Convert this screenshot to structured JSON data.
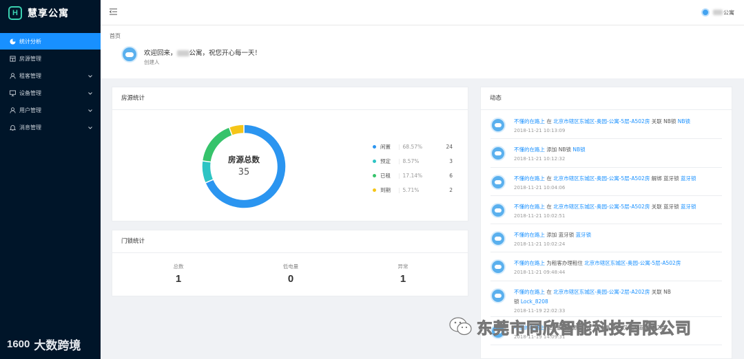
{
  "app": {
    "logo_mark": "H",
    "name": "慧享公寓"
  },
  "sidebar": {
    "items": [
      {
        "label": "统计分析",
        "icon": "pie-chart-icon",
        "active": true,
        "expandable": false
      },
      {
        "label": "房源管理",
        "icon": "building-icon",
        "active": false,
        "expandable": false
      },
      {
        "label": "租客管理",
        "icon": "user-icon",
        "active": false,
        "expandable": true
      },
      {
        "label": "设备管理",
        "icon": "monitor-icon",
        "active": false,
        "expandable": true
      },
      {
        "label": "用户管理",
        "icon": "user-icon",
        "active": false,
        "expandable": true
      },
      {
        "label": "消息管理",
        "icon": "bell-icon",
        "active": false,
        "expandable": true
      }
    ]
  },
  "topbar": {
    "user_name": "公寓"
  },
  "header": {
    "breadcrumb": "首页",
    "welcome_prefix": "欢迎回来，",
    "welcome_suffix": "公寓，祝您开心每一天！",
    "role": "创建人"
  },
  "room_stats": {
    "title": "房源统计",
    "center_label": "房源总数",
    "total": "35"
  },
  "chart_data": {
    "type": "pie",
    "title": "房源统计",
    "center_label": "房源总数",
    "total": 35,
    "slices": [
      {
        "name": "闲置",
        "percent": "68.57%",
        "value": 24,
        "color": "#2b95f0"
      },
      {
        "name": "预定",
        "percent": "8.57%",
        "value": 3,
        "color": "#2ec4c4"
      },
      {
        "name": "已租",
        "percent": "17.14%",
        "value": 6,
        "color": "#36c36b"
      },
      {
        "name": "到期",
        "percent": "5.71%",
        "value": 2,
        "color": "#f5c518"
      }
    ]
  },
  "lock_stats": {
    "title": "门锁统计",
    "items": [
      {
        "label": "总数",
        "value": "1"
      },
      {
        "label": "低电量",
        "value": "0"
      },
      {
        "label": "异常",
        "value": "1"
      }
    ]
  },
  "activity": {
    "title": "动态",
    "items": [
      {
        "user": "不懂的在路上",
        "parts": [
          {
            "t": " 在 "
          },
          {
            "t": "北京市辖区东城区-奥园-",
            "link": true
          },
          {
            "t": "公寓-5层-A502房",
            "link": true
          },
          {
            "t": " 关联 NB锁 "
          },
          {
            "t": "NB锁",
            "link": true
          }
        ],
        "time": "2018-11-21 10:13:09"
      },
      {
        "user": "不懂的在路上",
        "parts": [
          {
            "t": " 添加 NB锁 "
          },
          {
            "t": "NB锁",
            "link": true
          }
        ],
        "time": "2018-11-21 10:12:32"
      },
      {
        "user": "不懂的在路上",
        "parts": [
          {
            "t": " 在 "
          },
          {
            "t": "北京市辖区东城区-奥园-",
            "link": true
          },
          {
            "t": "公寓-5层-A502房",
            "link": true
          },
          {
            "t": " 解绑 蓝牙锁 "
          },
          {
            "t": "蓝牙锁",
            "link": true
          }
        ],
        "time": "2018-11-21 10:04:06"
      },
      {
        "user": "不懂的在路上",
        "parts": [
          {
            "t": " 在 "
          },
          {
            "t": "北京市辖区东城区-奥园-",
            "link": true
          },
          {
            "t": "公寓-5层-A502房",
            "link": true
          },
          {
            "t": " 关联 蓝牙锁 "
          },
          {
            "t": "蓝牙锁",
            "link": true
          }
        ],
        "time": "2018-11-21 10:02:51"
      },
      {
        "user": "不懂的在路上",
        "parts": [
          {
            "t": " 添加 蓝牙锁 "
          },
          {
            "t": "蓝牙锁",
            "link": true
          }
        ],
        "time": "2018-11-21 10:02:24"
      },
      {
        "user": "不懂的在路上",
        "parts": [
          {
            "t": " 为租客办理租住 "
          },
          {
            "t": "北京市辖区东城区-奥园-",
            "link": true
          },
          {
            "t": "公寓-5层-A502房",
            "link": true
          }
        ],
        "time": "2018-11-21 09:48:44"
      },
      {
        "user": "不懂的在路上",
        "parts": [
          {
            "t": " 在 "
          },
          {
            "t": "北京市辖区东城区-奥园-",
            "link": true
          },
          {
            "t": "公寓-2层-A202房",
            "link": true
          },
          {
            "t": " 关联 NB"
          }
        ],
        "parts2": [
          {
            "t": "锁 "
          },
          {
            "t": "Lock_8208",
            "link": true
          }
        ],
        "time": "2018-11-19 22:02:33"
      },
      {
        "user": "不懂的在路上",
        "parts": [
          {
            "t": " 批量删除房源 广东广州市番禺区-汉溪大道-四楼-2层"
          }
        ],
        "time": "2018-11-19 14:09:31"
      }
    ]
  },
  "watermarks": {
    "left": "大数跨境",
    "left_logo": "1600",
    "right": "东莞市同欣智能科技有限公司"
  }
}
